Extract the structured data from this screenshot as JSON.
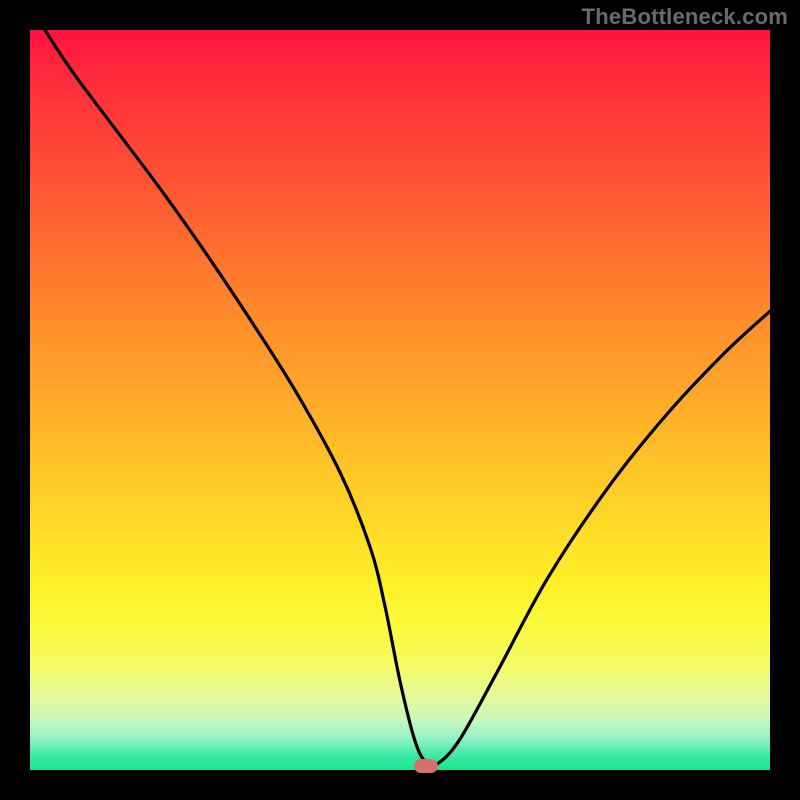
{
  "watermark": "TheBottleneck.com",
  "chart_data": {
    "type": "line",
    "title": "",
    "xlabel": "",
    "ylabel": "",
    "xlim": [
      0,
      100
    ],
    "ylim": [
      0,
      100
    ],
    "series": [
      {
        "name": "curve",
        "x": [
          2,
          6,
          12,
          18,
          24,
          30,
          36,
          42,
          46,
          48,
          50,
          52,
          53.5,
          55,
          58,
          63,
          70,
          78,
          86,
          94,
          100
        ],
        "values": [
          100,
          94,
          86,
          78,
          69.5,
          60.5,
          51,
          40,
          30,
          22,
          12,
          4,
          1,
          0.8,
          4,
          13,
          26,
          38,
          48,
          56.5,
          62
        ]
      }
    ],
    "marker": {
      "x": 53.5,
      "y": 0.5
    },
    "gradient_stops": [
      {
        "pct": 0,
        "color": "#ff1240"
      },
      {
        "pct": 50,
        "color": "#ffb028"
      },
      {
        "pct": 80,
        "color": "#fdfd35"
      },
      {
        "pct": 100,
        "color": "#17e68e"
      }
    ]
  }
}
